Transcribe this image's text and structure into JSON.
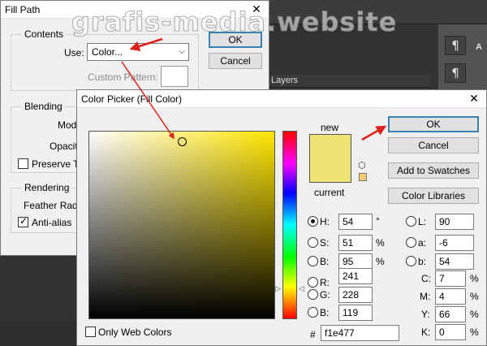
{
  "watermark": "grafis-media.website",
  "background": {
    "layers_tab": "Layers",
    "panel_icons": [
      "¶",
      "¶"
    ],
    "panel_glyph": "A"
  },
  "fill_path": {
    "title": "Fill Path",
    "ok_label": "OK",
    "cancel_label": "Cancel",
    "contents_label": "Contents",
    "use_label": "Use:",
    "use_value": "Color...",
    "custom_pattern_label": "Custom Pattern:",
    "blending_label": "Blending",
    "mode_label": "Mode",
    "opacity_label": "Opacity",
    "preserve_label": "Preserve Tra",
    "rendering_label": "Rendering",
    "feather_label": "Feather Radiu",
    "antialias_label": "Anti-alias",
    "preserve_checked": false,
    "antialias_checked": true
  },
  "color_picker": {
    "title": "Color Picker (Fill Color)",
    "new_label": "new",
    "current_label": "current",
    "new_color": "#f1e477",
    "current_color": "#f1e477",
    "ok_label": "OK",
    "cancel_label": "Cancel",
    "add_swatches_label": "Add to Swatches",
    "color_libraries_label": "Color Libraries",
    "only_web_label": "Only Web Colors",
    "hue_color": "#ffe600",
    "hsb": {
      "h": {
        "label": "H:",
        "value": "54",
        "unit": "°",
        "selected": true
      },
      "s": {
        "label": "S:",
        "value": "51",
        "unit": "%",
        "selected": false
      },
      "b": {
        "label": "B:",
        "value": "95",
        "unit": "%",
        "selected": false
      }
    },
    "rgb": {
      "r": {
        "label": "R:",
        "value": "241"
      },
      "g": {
        "label": "G:",
        "value": "228"
      },
      "b": {
        "label": "B:",
        "value": "119"
      }
    },
    "lab": {
      "l": {
        "label": "L:",
        "value": "90"
      },
      "a": {
        "label": "a:",
        "value": "-6"
      },
      "b": {
        "label": "b:",
        "value": "54"
      }
    },
    "cmyk": {
      "c": {
        "label": "C:",
        "value": "7",
        "unit": "%"
      },
      "m": {
        "label": "M:",
        "value": "4",
        "unit": "%"
      },
      "y": {
        "label": "Y:",
        "value": "66",
        "unit": "%"
      },
      "k": {
        "label": "K:",
        "value": "0",
        "unit": "%"
      }
    },
    "hex_label": "#",
    "hex_value": "f1e477"
  },
  "annotation_color": "#e0201c"
}
